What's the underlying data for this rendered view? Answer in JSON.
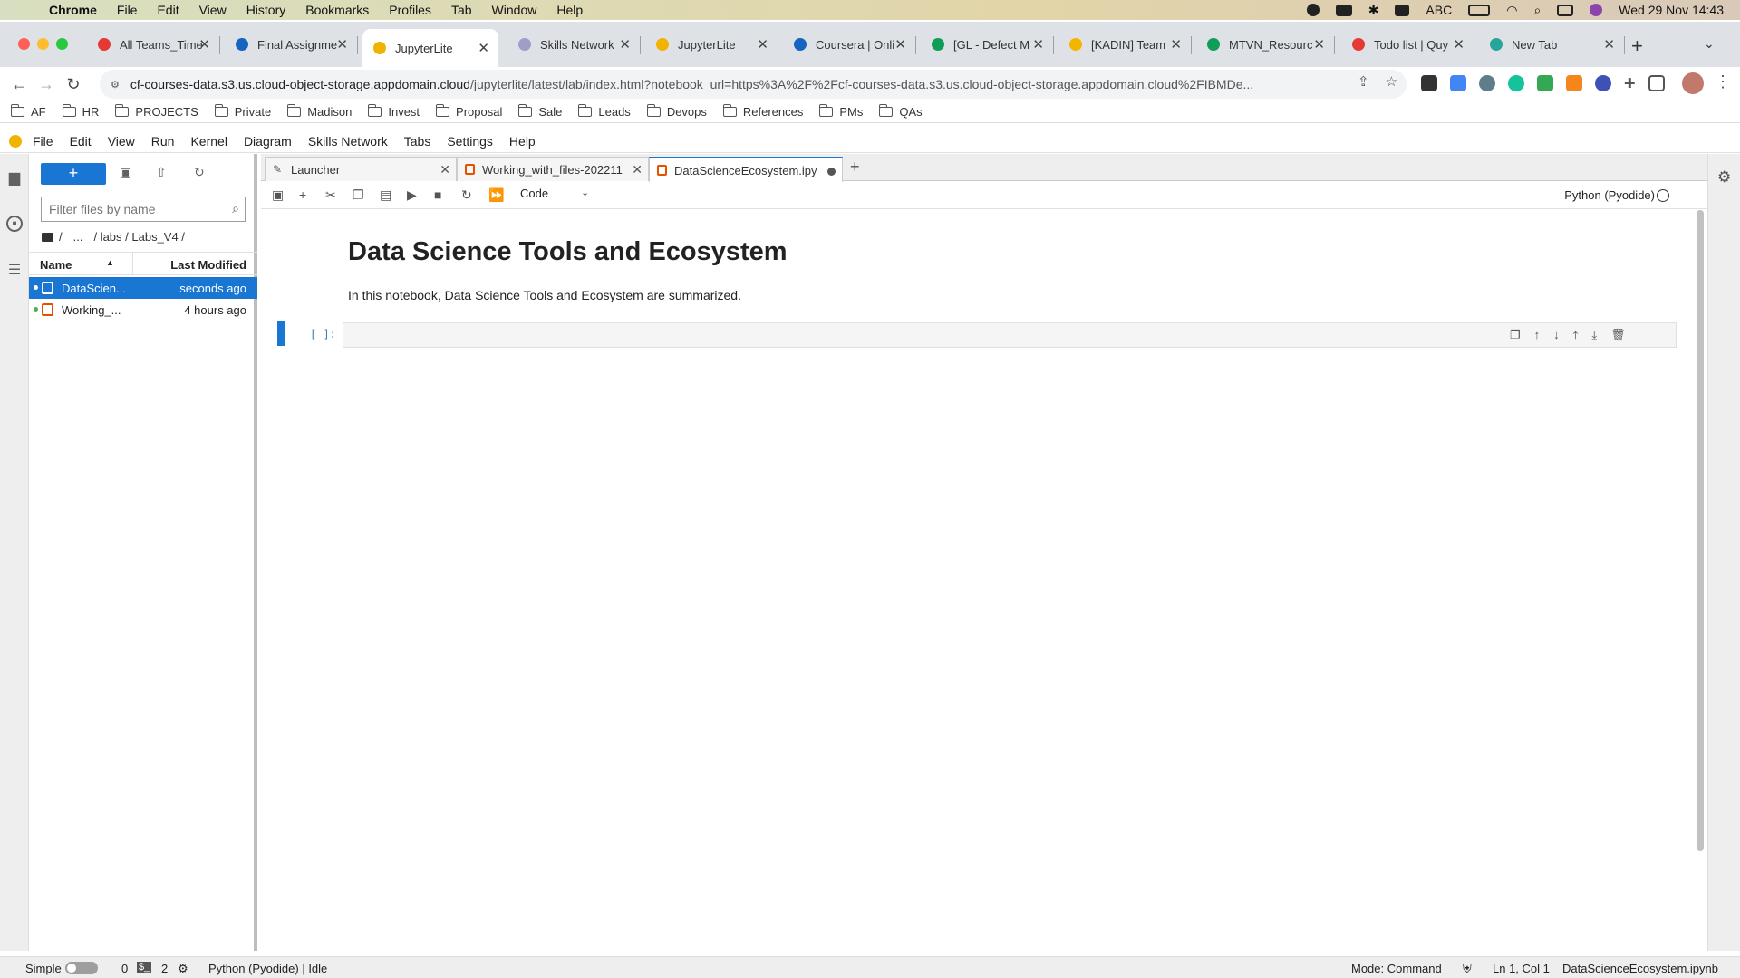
{
  "macos": {
    "app_name": "Chrome",
    "menus": [
      "File",
      "Edit",
      "View",
      "History",
      "Bookmarks",
      "Profiles",
      "Tab",
      "Window",
      "Help"
    ],
    "input_source": "ABC",
    "datetime": "Wed 29 Nov  14:43"
  },
  "browser": {
    "tabs": [
      {
        "title": "All Teams_Time",
        "color": "#e53935",
        "active": false
      },
      {
        "title": "Final Assignme",
        "color": "#1565c0",
        "active": false
      },
      {
        "title": "JupyterLite",
        "color": "#f0b400",
        "active": true
      },
      {
        "title": "Skills Network",
        "color": "#9e9ec8",
        "active": false
      },
      {
        "title": "JupyterLite",
        "color": "#f0b400",
        "active": false
      },
      {
        "title": "Coursera | Onli",
        "color": "#1565c0",
        "active": false
      },
      {
        "title": "[GL - Defect M",
        "color": "#0f9d58",
        "active": false
      },
      {
        "title": "[KADIN] Team",
        "color": "#f4b400",
        "active": false
      },
      {
        "title": "MTVN_Resourc",
        "color": "#0f9d58",
        "active": false
      },
      {
        "title": "Todo list | Quy",
        "color": "#e53935",
        "active": false
      },
      {
        "title": "New Tab",
        "color": "#26a69a",
        "active": false
      }
    ],
    "url_host": "cf-courses-data.s3.us.cloud-object-storage.appdomain.cloud",
    "url_path": "/jupyterlite/latest/lab/index.html?notebook_url=https%3A%2F%2Fcf-courses-data.s3.us.cloud-object-storage.appdomain.cloud%2FIBMDe...",
    "bookmarks": [
      "AF",
      "HR",
      "PROJECTS",
      "Private",
      "Madison",
      "Invest",
      "Proposal",
      "Sale",
      "Leads",
      "Devops",
      "References",
      "PMs",
      "QAs"
    ]
  },
  "jupyter": {
    "menu": [
      "File",
      "Edit",
      "View",
      "Run",
      "Kernel",
      "Diagram",
      "Skills Network",
      "Tabs",
      "Settings",
      "Help"
    ],
    "new_button": "+",
    "filter_placeholder": "Filter files by name",
    "breadcrumb": {
      "root": "/",
      "ellipsis": "...",
      "path": "/ labs / Labs_V4 /"
    },
    "columns": {
      "name": "Name",
      "modified": "Last Modified"
    },
    "files": [
      {
        "name": "DataScien...",
        "modified": "seconds ago",
        "selected": true
      },
      {
        "name": "Working_...",
        "modified": "4 hours ago",
        "selected": false
      }
    ],
    "doc_tabs": [
      {
        "label": "Launcher",
        "type": "launcher",
        "active": false
      },
      {
        "label": "Working_with_files-202211",
        "type": "notebook",
        "active": false
      },
      {
        "label": "DataScienceEcosystem.ipy",
        "type": "notebook",
        "active": true
      }
    ],
    "cell_type": "Code",
    "kernel_name": "Python (Pyodide)",
    "notebook": {
      "heading": "Data Science Tools and Ecosystem",
      "description": "In this notebook, Data Science Tools and Ecosystem are summarized.",
      "prompt": "[ ]:"
    },
    "status": {
      "mode_toggle": "Simple",
      "terminals": "0",
      "kernels": "2",
      "kernel_status": "Python (Pyodide) | Idle",
      "mode": "Mode: Command",
      "cursor": "Ln 1, Col 1",
      "filename": "DataScienceEcosystem.ipynb"
    }
  }
}
